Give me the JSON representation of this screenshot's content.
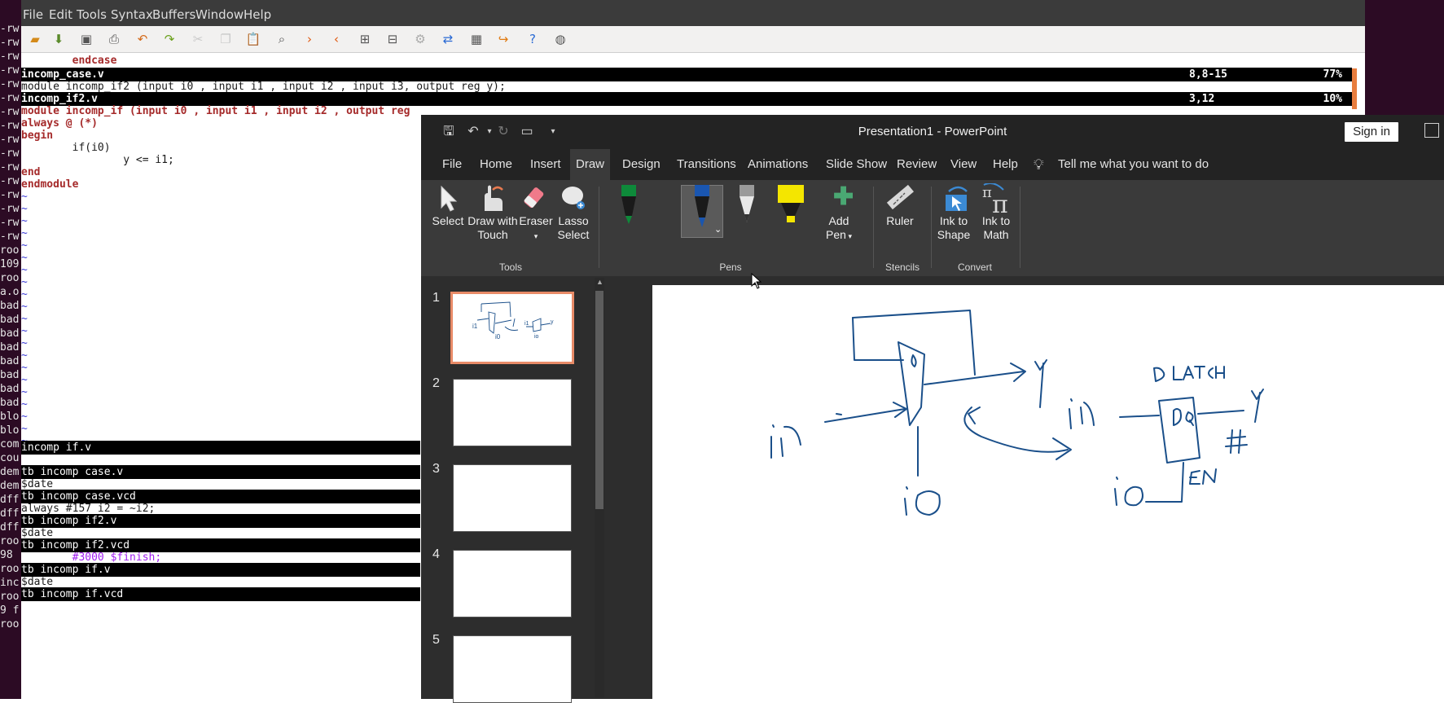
{
  "terminal": {
    "lines": [
      "-rw",
      "-rw",
      "-rw",
      "-rw",
      "-rw",
      "-rw",
      "-rw",
      "-rw",
      "-rw",
      "-rw",
      "-rw",
      "-rw",
      "-rw",
      "-rw",
      "-rw",
      "-rw",
      "roo",
      "109",
      "roo",
      "a.o",
      "bad",
      "bad",
      "bad",
      "bad",
      "bad",
      "bad",
      "bad",
      "bad",
      "blo",
      "blo",
      "com",
      "cou",
      "dem",
      "dem",
      "dff",
      "dff",
      "dff",
      "roo",
      "98",
      "roo",
      "inc",
      "roo",
      "9 f",
      "roo"
    ]
  },
  "gvim": {
    "menu": [
      "File",
      "Edit",
      "Tools",
      "Syntax",
      "Buffers",
      "Window",
      "Help"
    ],
    "toolbar_icons": [
      "open-icon",
      "save-session-icon",
      "save-icon",
      "print-icon",
      "undo-icon",
      "redo-icon",
      "cut-icon",
      "copy-icon",
      "paste-icon",
      "find-icon",
      "find-next-icon",
      "find-prev-icon",
      "load-session-icon",
      "save-session2-icon",
      "run-macro-icon",
      "make-icon",
      "ctags-icon",
      "jump-icon",
      "help-icon",
      "find-help-icon"
    ],
    "line_endcase": "        endcase",
    "status1": {
      "file": "incomp_case.v",
      "pos": "8,8-15",
      "pct": "77%"
    },
    "line_module2": "module incomp_if2 (input i0 , input i1 , input i2 , input i3, output reg y);",
    "status2": {
      "file": "incomp_if2.v",
      "pos": "3,12",
      "pct": "10%"
    },
    "line_module": "module incomp_if (input i0 , input i1 , input i2 , output reg",
    "line_always": "always @ (*)",
    "line_begin": "begin",
    "line_if": "        if(i0)",
    "line_assign": "                y <= i1;",
    "line_end": "end",
    "line_endmodule": "endmodule",
    "tilde": "~",
    "bottom": {
      "s1": "incomp if.v",
      "s2": "tb incomp case.v",
      "l1": "$date",
      "s3": "tb incomp case.vcd",
      "l2": "always #157 i2 = ~i2;",
      "s4": "tb incomp if2.v",
      "l3": "$date",
      "s5": "tb incomp if2.vcd",
      "l4": "        #3000 $finish;",
      "s6": "tb incomp if.v",
      "l5": "$date",
      "s7": "tb incomp if.vcd"
    }
  },
  "ppt": {
    "title": "Presentation1  -  PowerPoint",
    "sign_in": "Sign in",
    "tabs": [
      "File",
      "Home",
      "Insert",
      "Draw",
      "Design",
      "Transitions",
      "Animations",
      "Slide Show",
      "Review",
      "View",
      "Help"
    ],
    "active_tab": "Draw",
    "tell_me": "Tell me what you want to do",
    "ribbon": {
      "select": "Select",
      "draw_touch_1": "Draw with",
      "draw_touch_2": "Touch",
      "eraser": "Eraser",
      "lasso_1": "Lasso",
      "lasso_2": "Select",
      "add_pen_1": "Add",
      "add_pen_2": "Pen",
      "ruler": "Ruler",
      "ink_shape_1": "Ink to",
      "ink_shape_2": "Shape",
      "ink_math_1": "Ink to",
      "ink_math_2": "Math",
      "groups": {
        "tools": "Tools",
        "pens": "Pens",
        "stencils": "Stencils",
        "convert": "Convert"
      }
    },
    "slide_numbers": [
      "1",
      "2",
      "3",
      "4",
      "5"
    ],
    "ink_labels": {
      "dlatch": "D LATCH",
      "en": "EN",
      "d": "D",
      "q": "Q",
      "hash": "#"
    },
    "colors": {
      "ink": "#1a4f8a",
      "pen_green": "#0e8a3a",
      "pen_blue": "#1a56b0",
      "highlighter": "#f4e600",
      "selection": "#e88b68"
    }
  }
}
